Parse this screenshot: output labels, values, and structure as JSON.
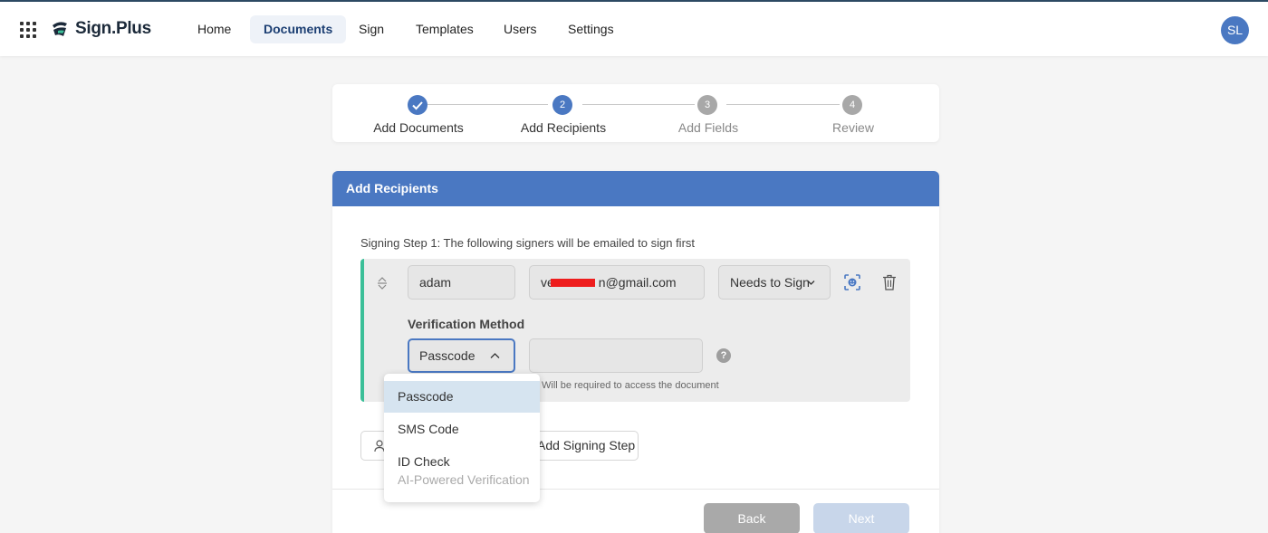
{
  "app": {
    "name": "Sign.Plus",
    "user_initials": "SL"
  },
  "nav": {
    "items": [
      {
        "label": "Home"
      },
      {
        "label": "Documents"
      },
      {
        "label": "Sign"
      },
      {
        "label": "Templates"
      },
      {
        "label": "Users"
      },
      {
        "label": "Settings"
      }
    ]
  },
  "stepper": {
    "steps": [
      {
        "number": "1",
        "label": "Add Documents",
        "state": "done"
      },
      {
        "number": "2",
        "label": "Add Recipients",
        "state": "current"
      },
      {
        "number": "3",
        "label": "Add Fields",
        "state": "todo"
      },
      {
        "number": "4",
        "label": "Review",
        "state": "todo"
      }
    ]
  },
  "card": {
    "title": "Add Recipients",
    "signing_step_text": "Signing Step 1: The following signers will be emailed to sign first",
    "signer": {
      "name": "adam",
      "email_prefix": "ve",
      "email_suffix": "n@gmail.com",
      "role": "Needs to Sign"
    },
    "verification": {
      "label": "Verification Method",
      "selected": "Passcode",
      "passcode_value": "",
      "hint": "Will be required to access the document"
    },
    "add_signing_step_label": "Add Signing Step",
    "back_label": "Back",
    "next_label": "Next"
  },
  "dropdown": {
    "options": [
      {
        "label": "Passcode",
        "sub": ""
      },
      {
        "label": "SMS Code",
        "sub": ""
      },
      {
        "label": "ID Check",
        "sub": "AI-Powered Verification"
      }
    ]
  },
  "colors": {
    "primary": "#4a78c2",
    "accent_green": "#3bbf98",
    "redaction": "#ee1d1d"
  }
}
